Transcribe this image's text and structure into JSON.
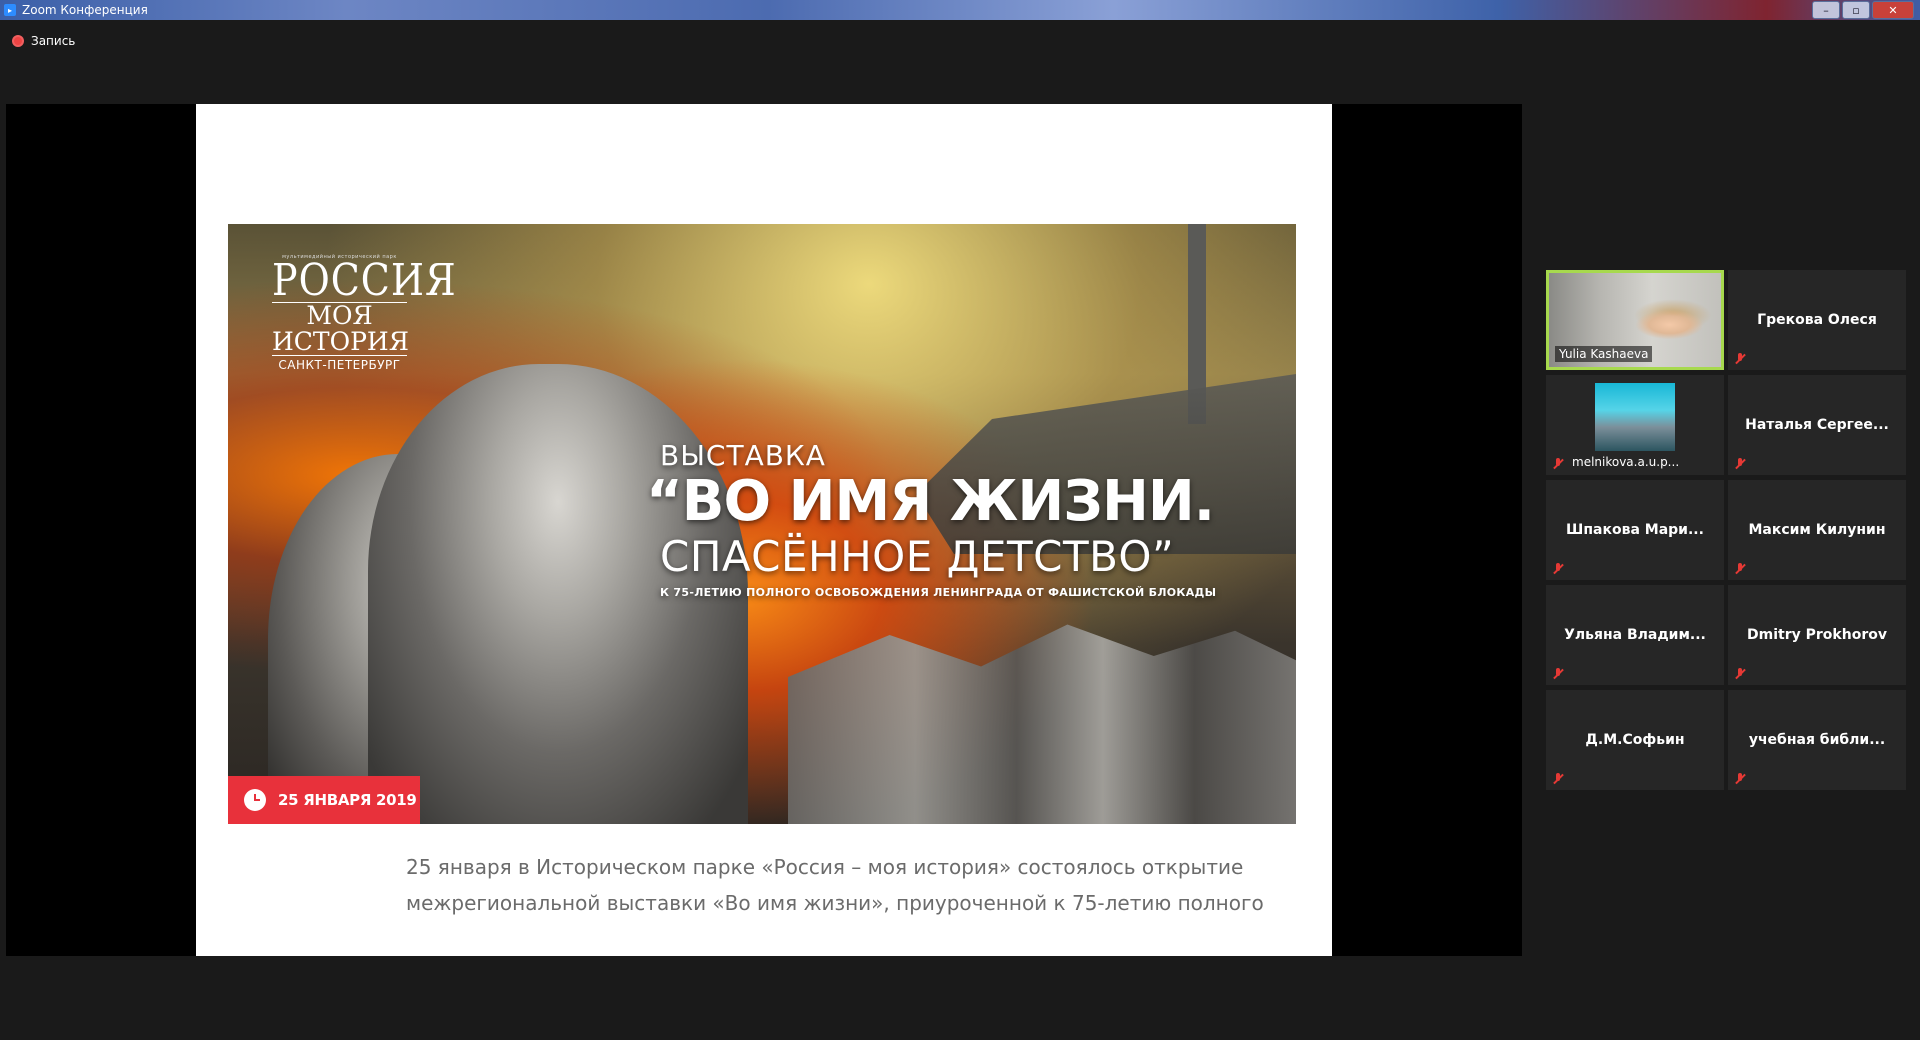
{
  "window": {
    "title": "Zoom Конференция",
    "app_icon": "zoom-icon"
  },
  "recording": {
    "label": "Запись",
    "color": "#e44444"
  },
  "slide": {
    "logo": {
      "tagline": "мультимедийный исторический парк",
      "line1": "РОССИЯ",
      "line2": "МОЯ ИСТОРИЯ",
      "line3": "САНКТ-ПЕТЕРБУРГ"
    },
    "headline": {
      "pre": "ВЫСТАВКА",
      "line1": "“ВО ИМЯ ЖИЗНИ.",
      "line2": "СПАСЁННОЕ ДЕТСТВО”",
      "sub": "К 75-ЛЕТИЮ ПОЛНОГО ОСВОБОЖДЕНИЯ ЛЕНИНГРАДА ОТ ФАШИСТСКОЙ БЛОКАДЫ"
    },
    "date_badge": {
      "text": "25 ЯНВАРЯ 2019",
      "color": "#e8313b",
      "icon": "clock-icon"
    },
    "body_line1": "25 января в Историческом парке «Россия – моя история» состоялось открытие",
    "body_line2": "межрегиональной выставки «Во имя жизни», приуроченной к 75-летию полного"
  },
  "participants": [
    {
      "name": "Yulia Kashaeva",
      "video": true,
      "active": true
    },
    {
      "name": "Грекова Олеся",
      "muted": true
    },
    {
      "name": "melnikova.a.u.p...",
      "thumbnail": true,
      "muted": true
    },
    {
      "name": "Наталья  Сергее...",
      "muted": true
    },
    {
      "name": "Шпакова  Мари...",
      "muted": true
    },
    {
      "name": "Максим Килунин",
      "muted": true
    },
    {
      "name": "Ульяна  Владим...",
      "muted": true
    },
    {
      "name": "Dmitry Prokhorov",
      "muted": true
    },
    {
      "name": "Д.М.Софьин",
      "muted": true
    },
    {
      "name": "учебная  библи...",
      "muted": true
    }
  ],
  "colors": {
    "active_speaker_border": "#a7d94e",
    "muted_icon": "#e53935"
  }
}
